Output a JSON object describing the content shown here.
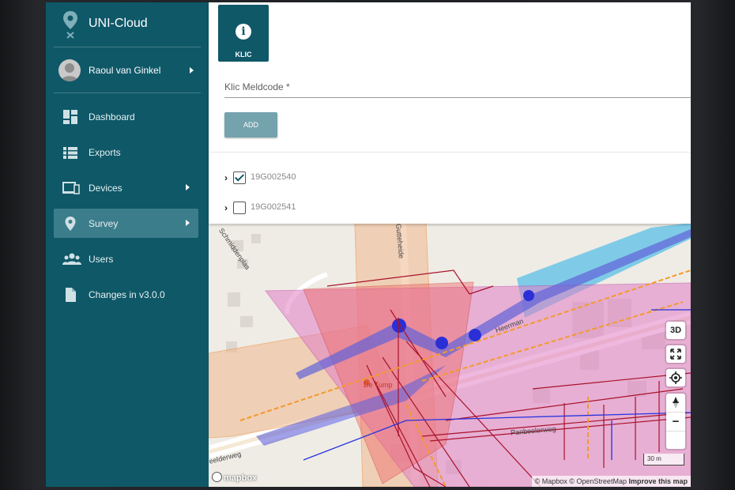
{
  "app": {
    "title": "UNI-Cloud"
  },
  "user": {
    "name": "Raoul van Ginkel"
  },
  "nav": [
    {
      "label": "Dashboard",
      "icon": "dashboard-icon",
      "active": false
    },
    {
      "label": "Exports",
      "icon": "list-icon",
      "active": false
    },
    {
      "label": "Devices",
      "icon": "devices-icon",
      "active": false
    },
    {
      "label": "Survey",
      "icon": "location-pin-icon",
      "active": true
    },
    {
      "label": "Users",
      "icon": "users-icon",
      "active": false
    },
    {
      "label": "Changes in v3.0.0",
      "icon": "document-icon",
      "active": false
    }
  ],
  "panel": {
    "tile_label": "KLIC",
    "field_placeholder": "Klic Meldcode *",
    "add_label": "ADD",
    "items": [
      {
        "code": "19G002540",
        "checked": true
      },
      {
        "code": "19G002541",
        "checked": false
      }
    ]
  },
  "map": {
    "controls": {
      "three_d": "3D",
      "zoom_in": "+",
      "zoom_out": "−"
    },
    "scale": "30 m",
    "attribution": {
      "mapbox": "© Mapbox",
      "osm": "© OpenStreetMap",
      "improve": "Improve this map"
    },
    "logo": "mapbox",
    "streets": [
      "Schmiddenplas",
      "Gutteheide",
      "Heerman",
      "Panbeelerweg",
      "eelderweg",
      "De Tump"
    ]
  },
  "colors": {
    "sidebar": "#0f5868",
    "active": "#3c7d8b",
    "add_button": "#74a3ae"
  }
}
